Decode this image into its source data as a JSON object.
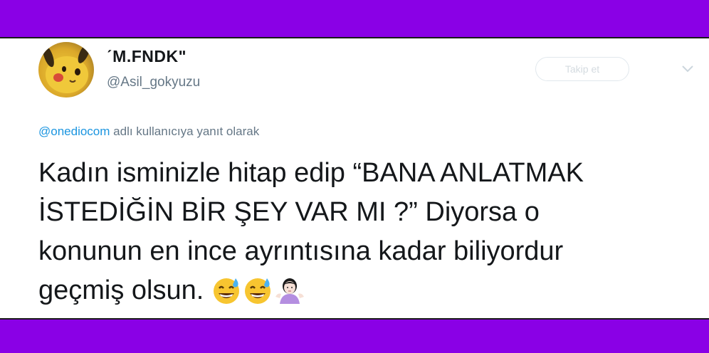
{
  "user": {
    "display_name": "ˊM.FNDKʺ",
    "handle": "@Asil_gokyuzu",
    "avatar": "pikachu-avatar"
  },
  "follow_button": {
    "label": "Takip et"
  },
  "reply_context": {
    "mention": "@onediocom",
    "suffix": " adlı kullanıcıya yanıt olarak"
  },
  "tweet": {
    "lines": [
      "Kadın isminizle hitap edip “BANA ANLATMAK",
      "İSTEDİĞİN BİR ŞEY VAR MI ?” Diyorsa o",
      "konunun en ince ayrıntısına kadar biliyordur",
      "geçmiş olsun."
    ],
    "emojis": [
      "grinning-sweat-emoji",
      "grinning-sweat-emoji",
      "person-shrugging-emoji"
    ]
  },
  "colors": {
    "frame": "#8a00e6",
    "link": "#1b95e0",
    "text": "#14171a",
    "secondary": "#657786"
  }
}
